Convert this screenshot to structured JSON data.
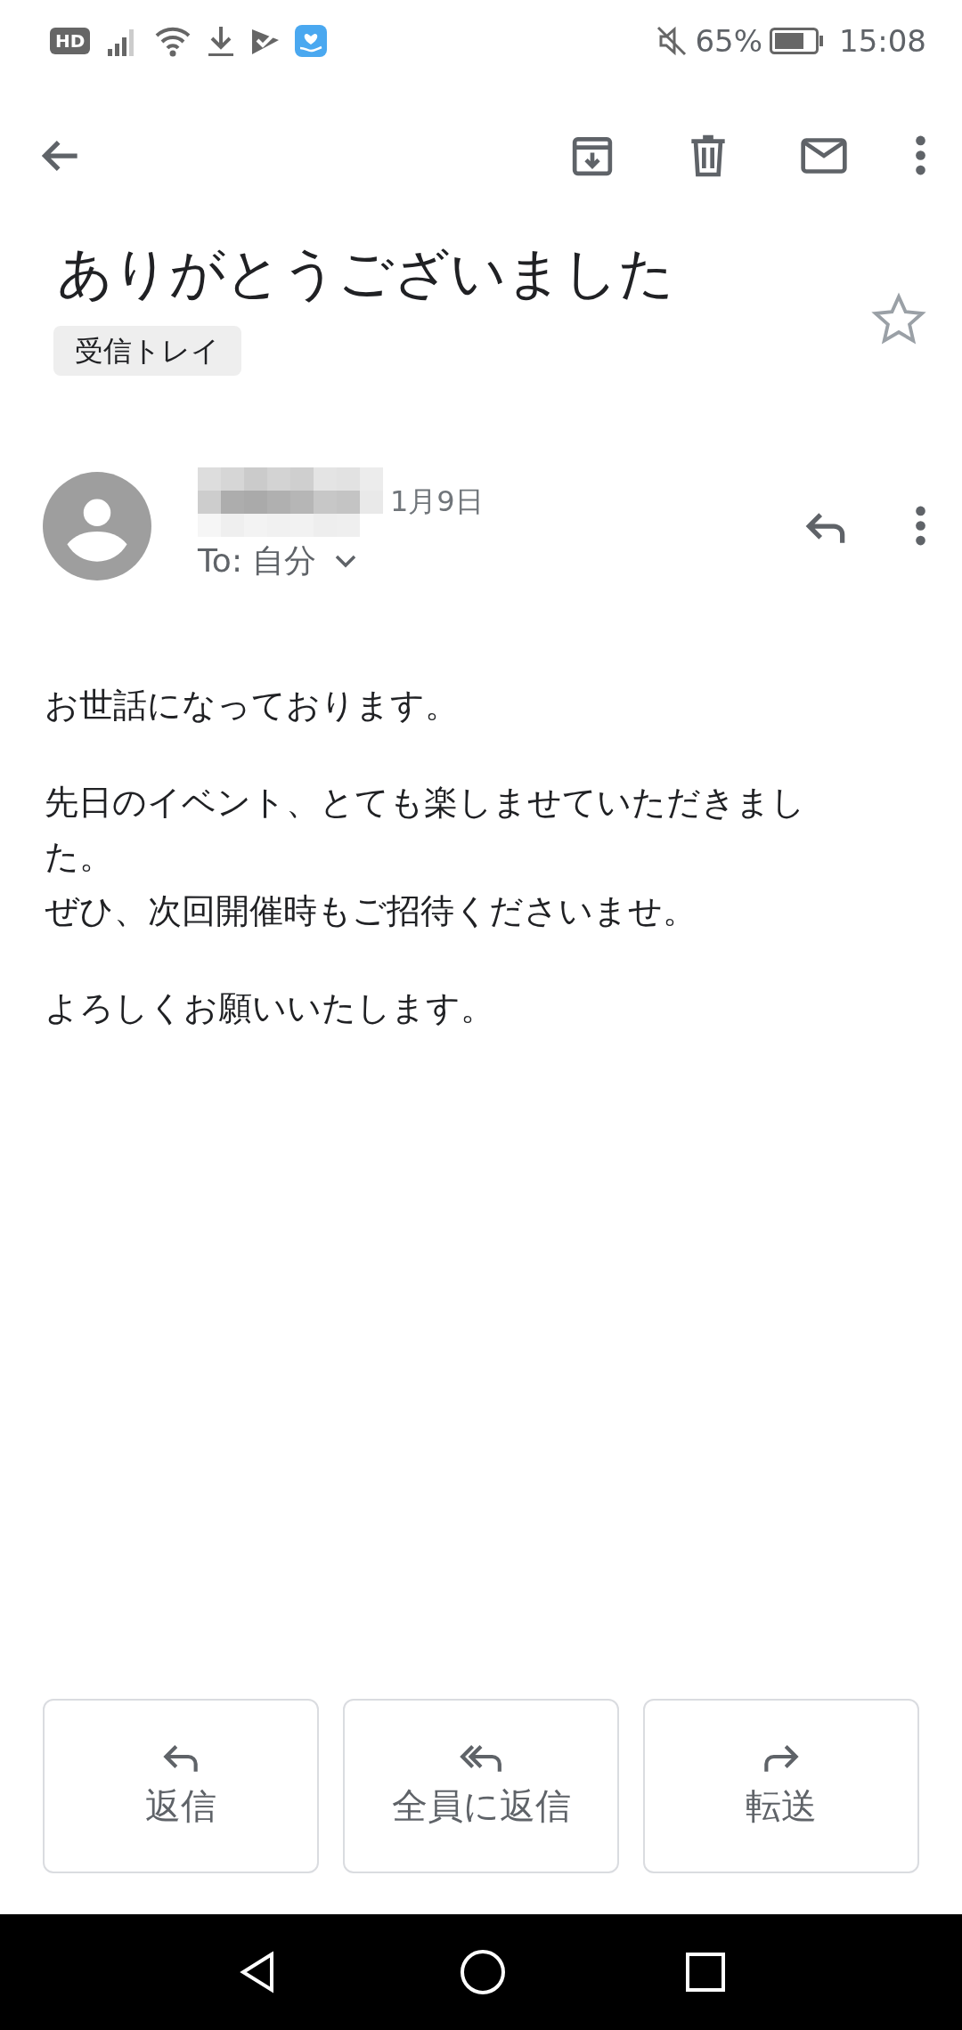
{
  "status_bar": {
    "hd_badge": "HD",
    "battery_percent": "65%",
    "time": "15:08"
  },
  "message": {
    "subject": "ありがとうございました",
    "labels": [
      "受信トレイ"
    ],
    "starred": false,
    "date": "1月9日",
    "recipient": "To: 自分",
    "body": [
      [
        "お世話になっております。"
      ],
      [
        "先日のイベント、とても楽しませていただきました。",
        "ぜひ、次回開催時もご招待くださいませ。"
      ],
      [
        "よろしくお願いいたします。"
      ]
    ]
  },
  "actions": [
    {
      "label": "返信",
      "kind": "reply"
    },
    {
      "label": "全員に返信",
      "kind": "reply_all"
    },
    {
      "label": "転送",
      "kind": "forward"
    }
  ]
}
